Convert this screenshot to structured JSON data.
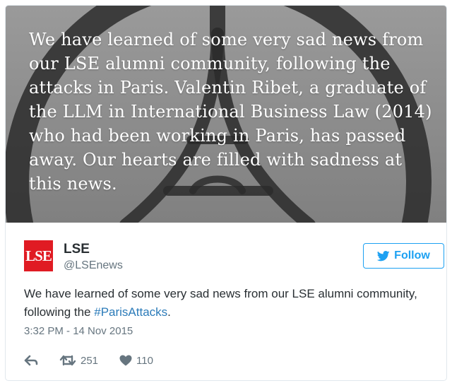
{
  "banner": {
    "text": "We have learned of some very sad news from our LSE alumni community, following the attacks in Paris. Valentin Ribet, a graduate of the LLM in International Business Law (2014) who had been working in Paris, has passed away. Our hearts are filled with sadness at this news."
  },
  "account": {
    "logo_text": "LSE",
    "logo_color": "#e01b23",
    "name": "LSE",
    "handle": "@LSEnews"
  },
  "follow_button": {
    "label": "Follow",
    "icon": "twitter-bird-icon",
    "color": "#1da1f2"
  },
  "tweet": {
    "text_before": "We have learned of some very sad news from our LSE alumni community, following the ",
    "hashtag": "#ParisAttacks",
    "text_after": ".",
    "hashtag_color": "#2b7bb9",
    "timestamp": "3:32 PM - 14 Nov 2015"
  },
  "actions": {
    "reply_icon": "reply-icon",
    "retweet_icon": "retweet-icon",
    "retweet_count": "251",
    "like_icon": "heart-icon",
    "like_count": "110"
  }
}
